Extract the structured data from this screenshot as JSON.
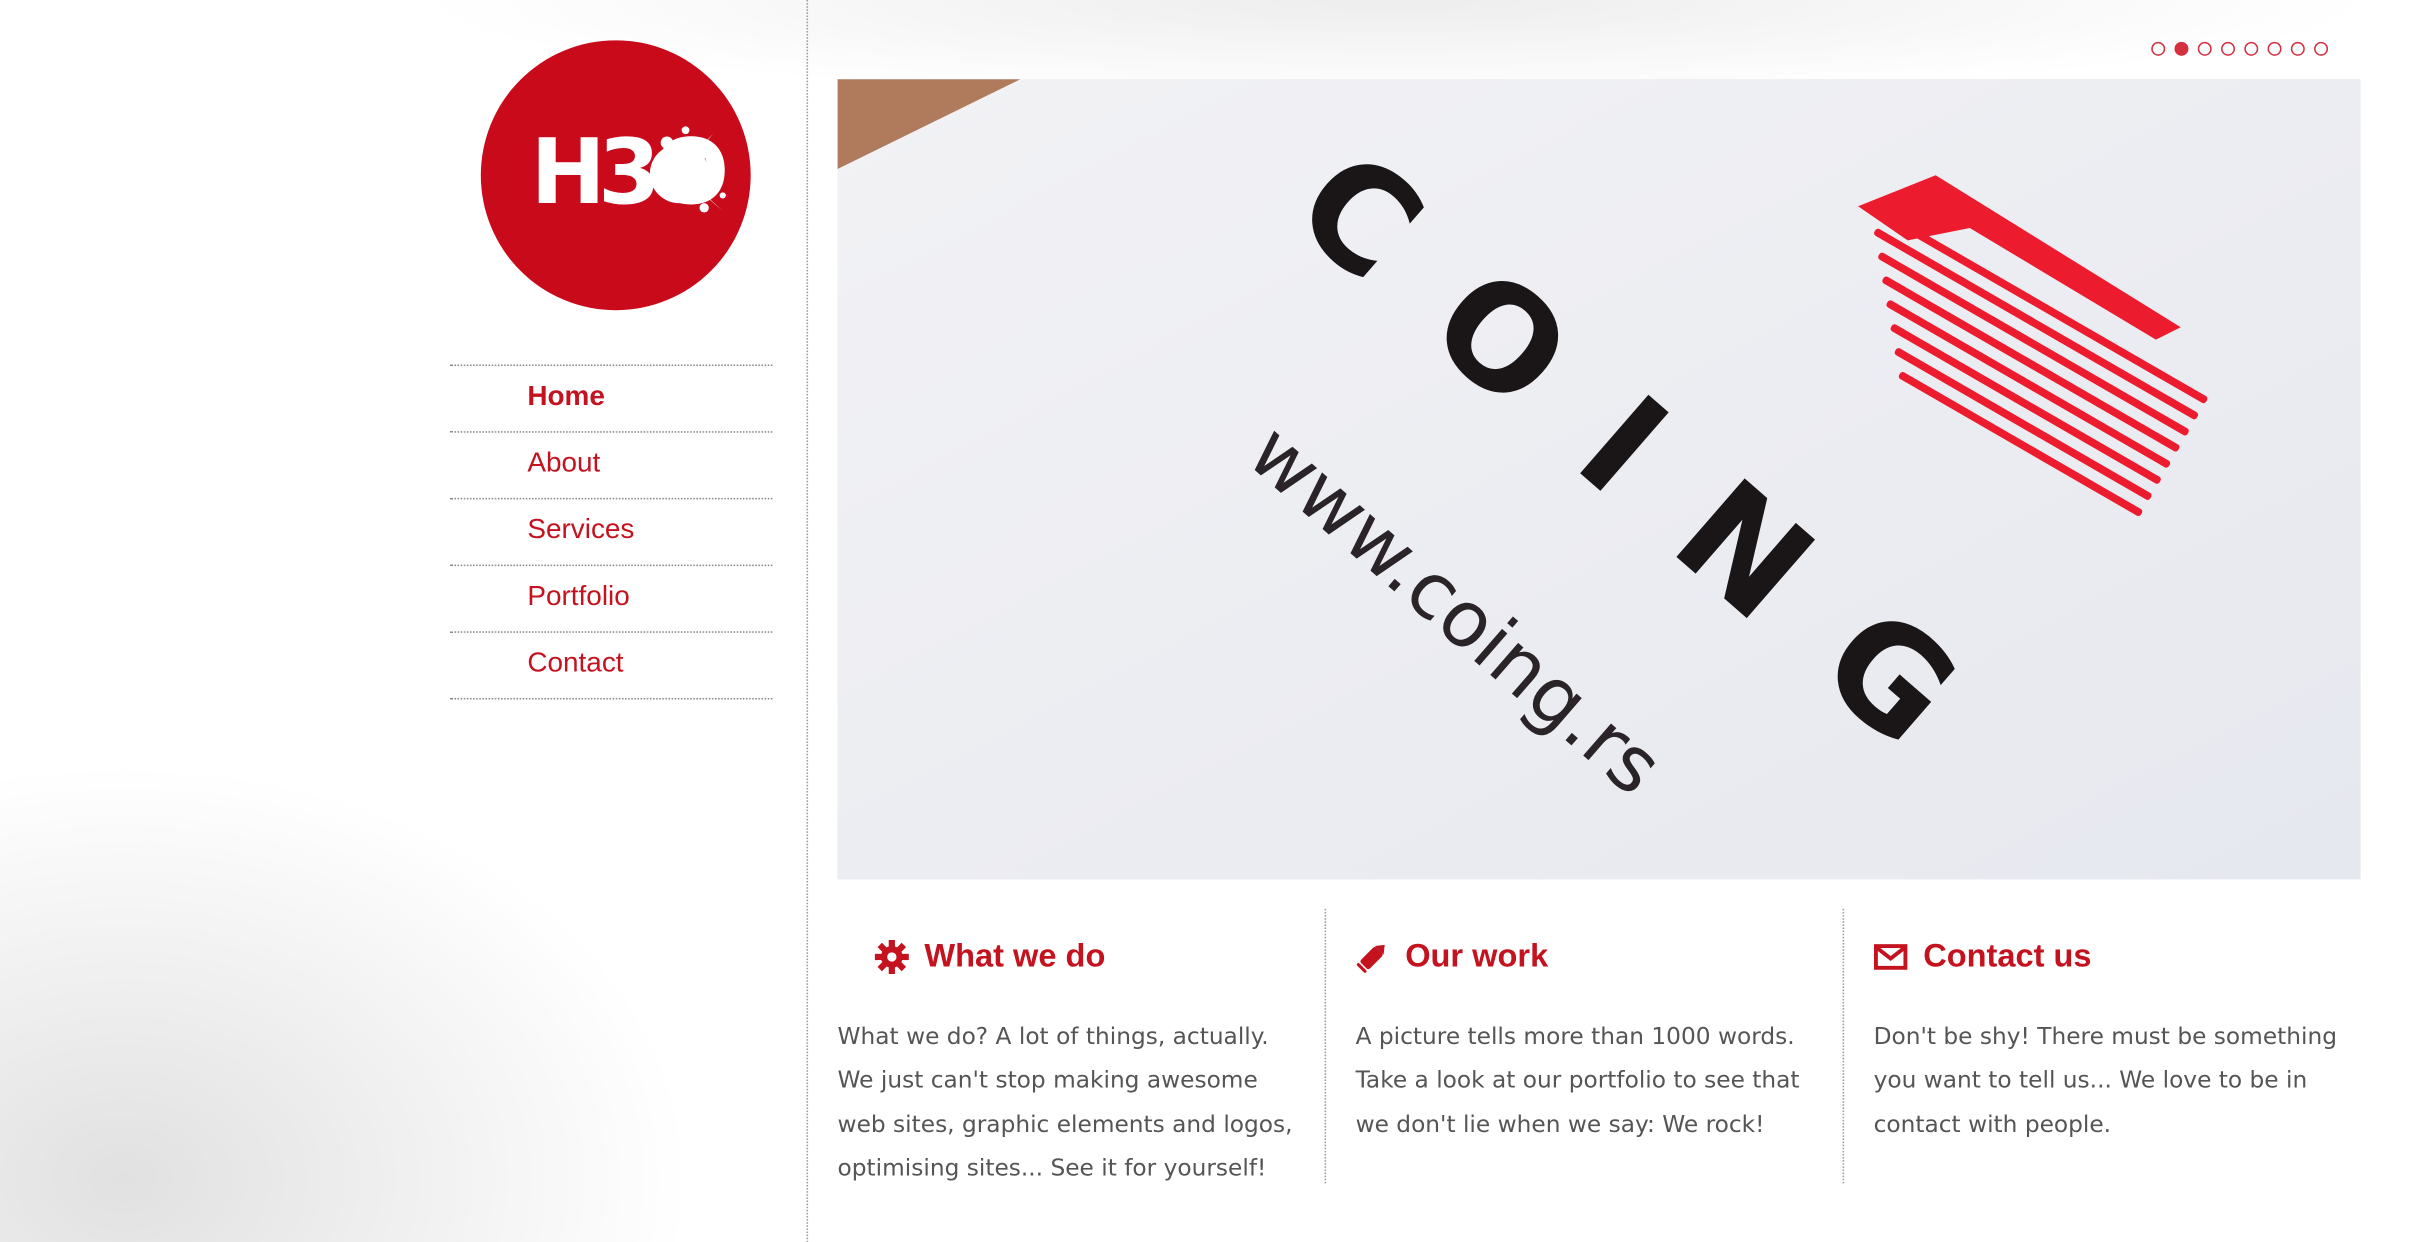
{
  "logo": {
    "text": "H3O"
  },
  "nav": {
    "items": [
      {
        "label": "Home",
        "active": true
      },
      {
        "label": "About",
        "active": false
      },
      {
        "label": "Services",
        "active": false
      },
      {
        "label": "Portfolio",
        "active": false
      },
      {
        "label": "Contact",
        "active": false
      }
    ]
  },
  "slider": {
    "dot_count": 8,
    "active_index": 1
  },
  "hero": {
    "brand_text": "COING",
    "url_text": "www.coing.rs"
  },
  "sections": [
    {
      "icon": "gear-icon",
      "title": "What we do",
      "text": "What we do? A lot of things, actually. We just can't stop making awesome web sites, graphic elements and logos, optimising sites... See it for yourself!"
    },
    {
      "icon": "pencil-icon",
      "title": "Our work",
      "text": "A picture tells more than 1000 words. Take a look at our portfolio to see that we don't lie when we say: We rock!"
    },
    {
      "icon": "envelope-icon",
      "title": "Contact us",
      "text": "Don't be shy! There must be something you want to tell us... We love to be in contact with people."
    }
  ],
  "colors": {
    "accent": "#c4121f",
    "logo_red": "#c90a1b",
    "text": "#555555"
  }
}
